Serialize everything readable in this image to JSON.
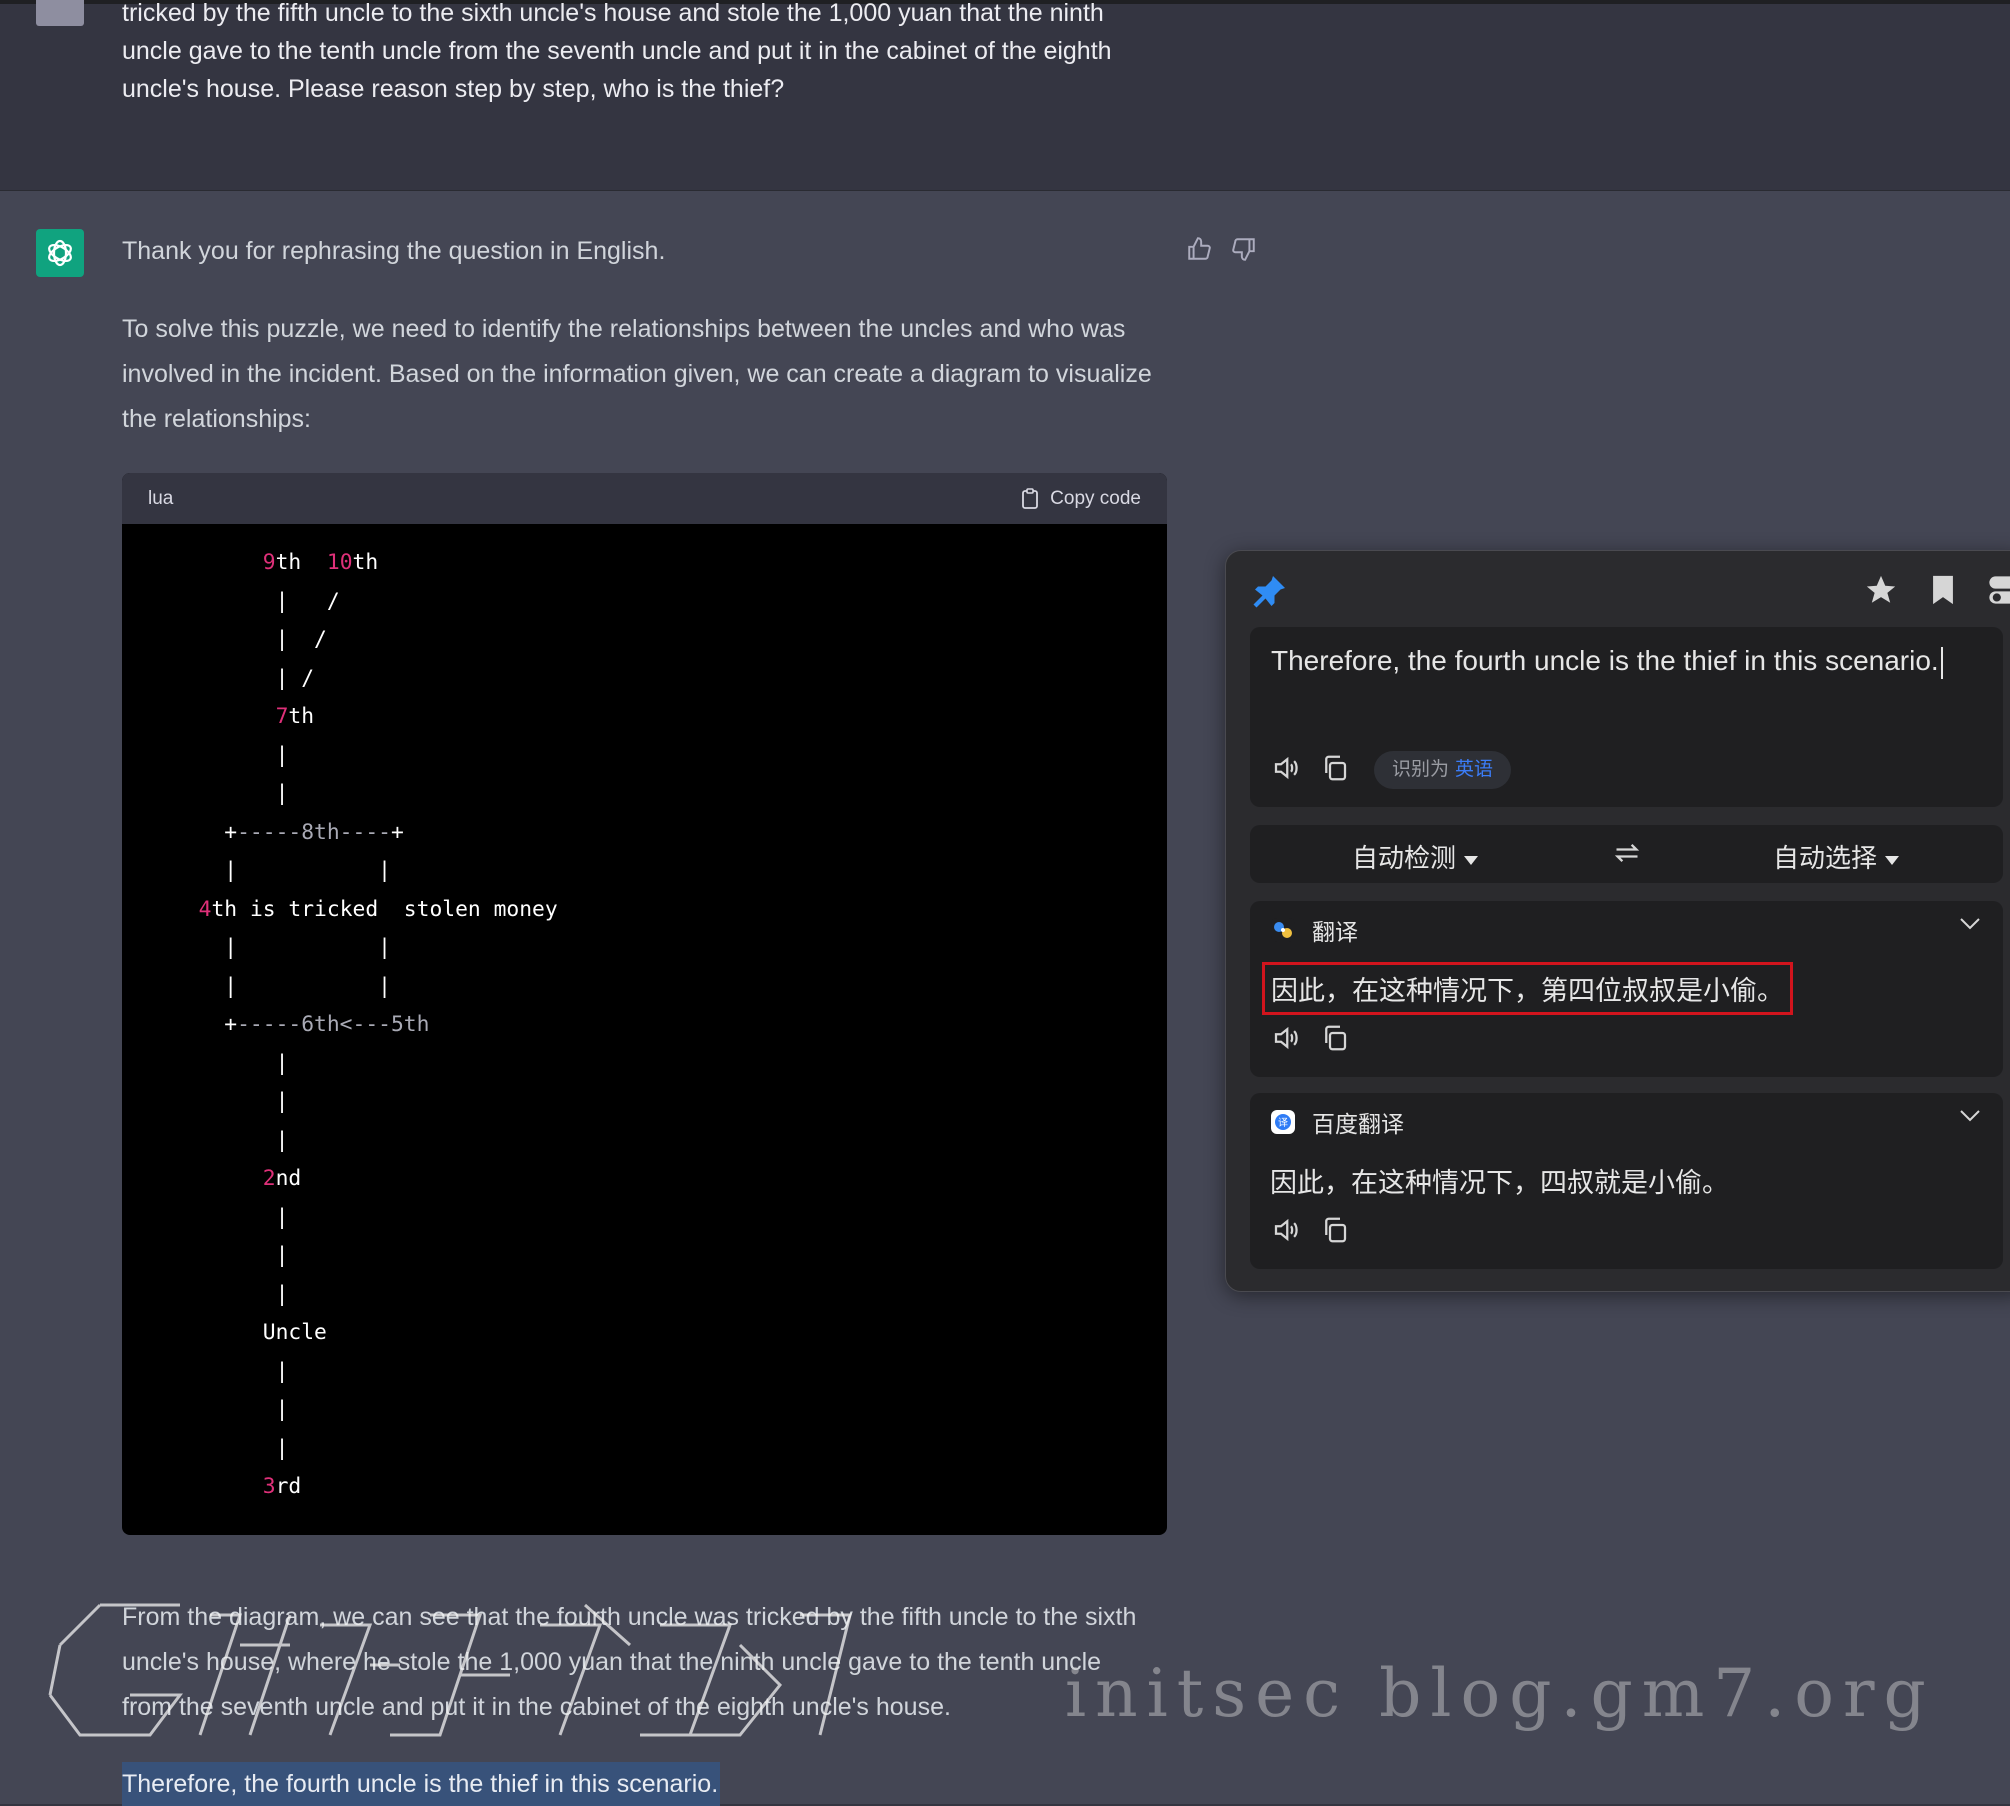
{
  "user_message": {
    "lines": [
      "tricked by the fifth uncle to the sixth uncle's house and stole the 1,000 yuan that the ninth",
      "uncle gave to the tenth uncle from the seventh uncle and put it in the cabinet of the eighth",
      "uncle's house. Please reason step by step, who is the thief?"
    ]
  },
  "assistant": {
    "intro": "Thank you for rephrasing the question in English.",
    "explain": "To solve this puzzle, we need to identify the relationships between the uncles and who was involved in the incident. Based on the information given, we can create a diagram to visualize the relationships:",
    "code_language": "lua",
    "copy_label": "Copy code",
    "code_lines": [
      [
        {
          "t": "       "
        },
        {
          "t": "9",
          "c": "num"
        },
        {
          "t": "th  "
        },
        {
          "t": "10",
          "c": "num"
        },
        {
          "t": "th"
        }
      ],
      [
        {
          "t": "        |   /"
        }
      ],
      [
        {
          "t": "        |  /"
        }
      ],
      [
        {
          "t": "        | /"
        }
      ],
      [
        {
          "t": "        "
        },
        {
          "t": "7",
          "c": "num"
        },
        {
          "t": "th"
        }
      ],
      [
        {
          "t": "        |"
        }
      ],
      [
        {
          "t": "        |"
        }
      ],
      [
        {
          "t": "    +"
        },
        {
          "t": "-----8th----",
          "c": "dim"
        },
        {
          "t": "+"
        }
      ],
      [
        {
          "t": "    |           |"
        }
      ],
      [
        {
          "t": "  "
        },
        {
          "t": "4",
          "c": "num"
        },
        {
          "t": "th is tricked  stolen money"
        }
      ],
      [
        {
          "t": "    |           |"
        }
      ],
      [
        {
          "t": "    |           |"
        }
      ],
      [
        {
          "t": "    +"
        },
        {
          "t": "-----6th<---5th",
          "c": "dim"
        }
      ],
      [
        {
          "t": "        |"
        }
      ],
      [
        {
          "t": "        |"
        }
      ],
      [
        {
          "t": "        |"
        }
      ],
      [
        {
          "t": "       "
        },
        {
          "t": "2",
          "c": "num"
        },
        {
          "t": "nd"
        }
      ],
      [
        {
          "t": "        |"
        }
      ],
      [
        {
          "t": "        |"
        }
      ],
      [
        {
          "t": "        |"
        }
      ],
      [
        {
          "t": "       Uncle"
        }
      ],
      [
        {
          "t": "        |"
        }
      ],
      [
        {
          "t": "        |"
        }
      ],
      [
        {
          "t": "        |"
        }
      ],
      [
        {
          "t": "       "
        },
        {
          "t": "3",
          "c": "num"
        },
        {
          "t": "rd"
        }
      ]
    ],
    "conclusion_lines": [
      "From the diagram, we can see that the fourth uncle was tricked by the fifth uncle to the sixth",
      "uncle's house, where he stole the 1,000 yuan that the ninth uncle gave to the tenth uncle",
      "from the seventh uncle and put it in the cabinet of the eighth uncle's house."
    ],
    "final": "Therefore, the fourth uncle is the thief in this scenario."
  },
  "translator": {
    "input_text": "Therefore, the fourth uncle is the thief in this scenario.",
    "detected_label": "识别为",
    "detected_lang": "英语",
    "source_lang": "自动检测",
    "target_lang": "自动选择",
    "results": [
      {
        "name": "翻译",
        "text": "因此，在这种情况下，第四位叔叔是小偷。"
      },
      {
        "name": "百度翻译",
        "text": "因此，在这种情况下，四叔就是小偷。"
      }
    ]
  },
  "watermark": "initsec blog.gm7.org",
  "colors": {
    "page_bg": "#343541",
    "assistant_bg": "#444654",
    "accent_green": "#10a37f",
    "number_pink": "#df3079",
    "highlight_box": "#d1141d",
    "link_blue": "#3b7cf6"
  }
}
